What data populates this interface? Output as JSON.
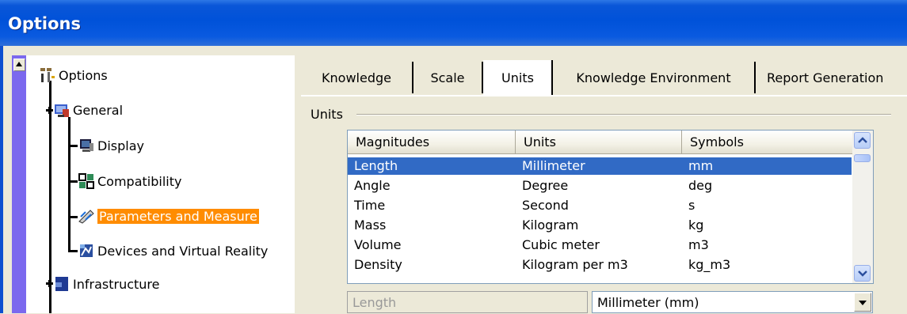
{
  "window": {
    "title": "Options"
  },
  "tree": {
    "root": {
      "label": "Options",
      "icon": "options-icon"
    },
    "items": [
      {
        "label": "General",
        "icon": "general-icon"
      },
      {
        "label": "Display",
        "icon": "display-icon"
      },
      {
        "label": "Compatibility",
        "icon": "compatibility-icon"
      },
      {
        "label": "Parameters and Measure",
        "icon": "parameters-icon",
        "selected": true
      },
      {
        "label": "Devices and Virtual Reality",
        "icon": "devices-icon"
      },
      {
        "label": "Infrastructure",
        "icon": "infrastructure-icon"
      }
    ]
  },
  "tabs": [
    {
      "label": "Knowledge"
    },
    {
      "label": "Scale"
    },
    {
      "label": "Units",
      "active": true
    },
    {
      "label": "Knowledge Environment"
    },
    {
      "label": "Report Generation"
    }
  ],
  "units_group": {
    "title": "Units",
    "columns": [
      "Magnitudes",
      "Units",
      "Symbols"
    ],
    "rows": [
      [
        "Length",
        "Millimeter",
        "mm"
      ],
      [
        "Angle",
        "Degree",
        "deg"
      ],
      [
        "Time",
        "Second",
        "s"
      ],
      [
        "Mass",
        "Kilogram",
        "kg"
      ],
      [
        "Volume",
        "Cubic meter",
        "m3"
      ],
      [
        "Density",
        "Kilogram per m3",
        "kg_m3"
      ]
    ],
    "selected_row": 0,
    "magnitude_field": "Length",
    "unit_select": "Millimeter (mm)"
  },
  "colors": {
    "titlebar": "#0052d9",
    "tree_selection": "#ff8c00",
    "row_selection": "#316ac5"
  }
}
